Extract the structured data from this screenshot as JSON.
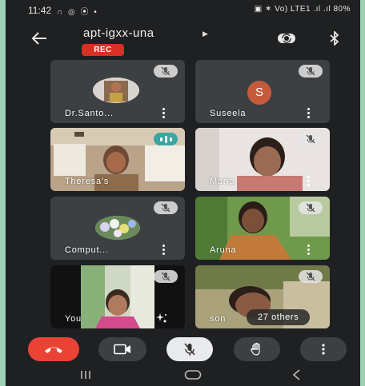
{
  "status_bar": {
    "time": "11:42",
    "left_icons": "∩ ◎ ⦿ •",
    "right_text": "▣ ✶ Vo) LTE1 .ıl .ıl 80%"
  },
  "header": {
    "meeting_code": "apt-igxx-una",
    "rec_badge": "REC"
  },
  "tiles": [
    {
      "name": "Dr.Santo...",
      "muted": true
    },
    {
      "name": "Suseela",
      "muted": true,
      "initial": "S"
    },
    {
      "name": "Theresa's",
      "muted": false,
      "speaking": true
    },
    {
      "name": "Maria",
      "muted": true
    },
    {
      "name": "Comput...",
      "muted": true
    },
    {
      "name": "Aruna",
      "muted": true
    },
    {
      "name": "You",
      "muted": true
    },
    {
      "name": "son",
      "muted": true,
      "others_label": "27 others"
    }
  ],
  "controls": {
    "end_call": "end-call-icon",
    "camera": "video-camera-icon",
    "microphone": "microphone-off-icon",
    "raise_hand": "hand-icon",
    "more": "more-vertical-icon"
  },
  "nav": {
    "recents": "|||",
    "home": "▭",
    "back": "<"
  },
  "colors": {
    "background": "#1f2022",
    "tile": "#3c4043",
    "end_call": "#ea4335",
    "rec": "#d93025",
    "speaking": "#3aa6a0",
    "frame": "#9fcfb4"
  }
}
